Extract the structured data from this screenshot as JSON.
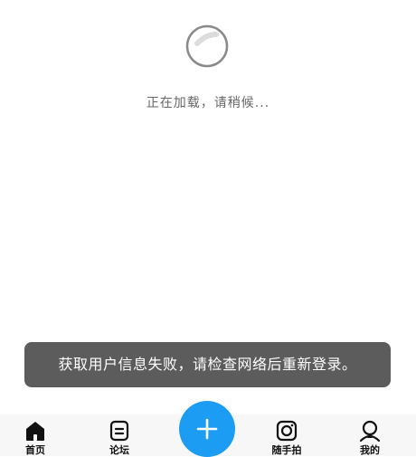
{
  "loading": {
    "text": "正在加载，请稍候..."
  },
  "toast": {
    "message": "获取用户信息失败，请检查网络后重新登录。"
  },
  "tabbar": {
    "tabs": [
      {
        "label": "首页",
        "icon": "home-icon"
      },
      {
        "label": "论坛",
        "icon": "forum-icon"
      },
      {
        "label": "",
        "icon": "plus-icon"
      },
      {
        "label": "随手拍",
        "icon": "camera-icon"
      },
      {
        "label": "我的",
        "icon": "profile-icon"
      }
    ],
    "fab_color": "#1c9df3"
  }
}
